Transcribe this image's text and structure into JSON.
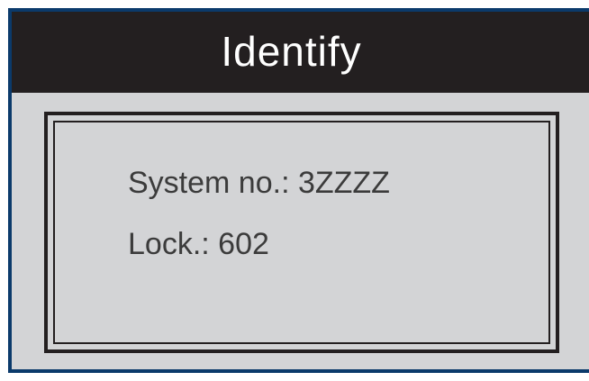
{
  "title": "Identify",
  "info": {
    "system_label": "System no.:",
    "system_value": "3ZZZZ",
    "lock_label": "Lock.:",
    "lock_value": "602"
  },
  "colors": {
    "titlebar_bg": "#231f20",
    "screen_bg": "#d3d4d6",
    "frame_border": "#0b3a6b",
    "text": "#3b3b3b"
  }
}
